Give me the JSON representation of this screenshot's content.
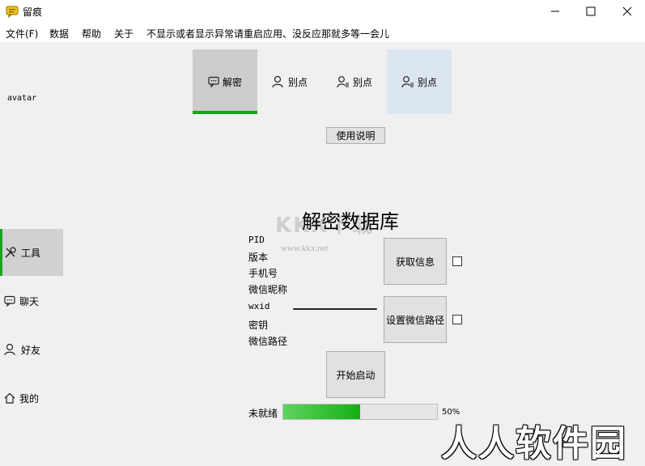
{
  "window": {
    "title": "留痕",
    "controls": [
      "minimize",
      "maximize",
      "close"
    ]
  },
  "menubar": {
    "items": [
      "文件(F)",
      "数据",
      "帮助",
      "关于",
      "不显示或者显示异常请重启应用、没反应那就多等一会儿"
    ]
  },
  "sidebar": {
    "avatar": "avatar",
    "items": [
      {
        "label": "工具",
        "icon": "tools-icon",
        "active": true
      },
      {
        "label": "聊天",
        "icon": "chat-icon"
      },
      {
        "label": "好友",
        "icon": "person-icon"
      },
      {
        "label": "我的",
        "icon": "home-icon"
      }
    ]
  },
  "top_tabs": [
    {
      "label": "解密",
      "icon": "chat-bubble-icon",
      "active": true
    },
    {
      "label": "别点",
      "icon": "person-icon"
    },
    {
      "label": "别点",
      "icon": "person-list-icon"
    },
    {
      "label": "别点",
      "icon": "person-list-icon",
      "highlight": true
    }
  ],
  "main": {
    "help_button": "使用说明",
    "heading": "解密数据库",
    "info_labels": [
      "PID",
      "版本",
      "手机号",
      "微信昵称",
      "wxid",
      "密钥",
      "微信路径"
    ],
    "get_info_button": "获取信息",
    "set_path_button": "设置微信路径",
    "start_button": "开始启动",
    "status": "未就绪",
    "progress": {
      "percent": 50,
      "text": "50%"
    }
  },
  "watermarks": {
    "kkx_logo": "KKX下载",
    "kkx_url": "www.kkx.net",
    "rrrj": "人人软件园"
  },
  "colors": {
    "accent_green": "#19a319",
    "active_tab_bg": "#cccccc",
    "highlight_tab_bg": "#dce6f0"
  }
}
